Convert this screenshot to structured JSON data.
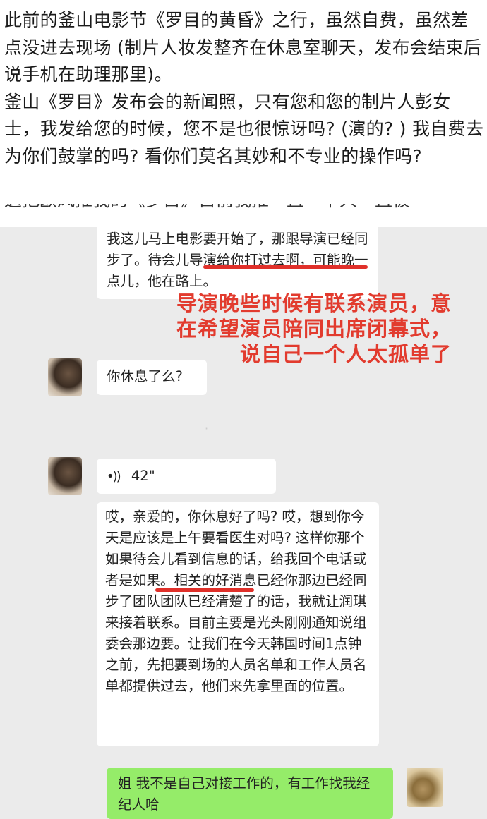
{
  "post": {
    "paragraph1": "此前的釜山电影节《罗目的黄昏》之行，虽然自费，虽然差点没进去现场 (制片人妆发整齐在休息室聊天，发布会结束后说手机在助理那里)。",
    "paragraph2": "釜山《罗目》发布会的新闻照，只有您和您的制片人彭女士，我发给您的时候，您不是也很惊讶吗? (演的? ) 我自费去为你们鼓掌的吗? 看你们莫名其妙和不专业的操作吗?",
    "cut_line": "这把欧风推我的《罗目》目前我推一直一下人一直被"
  },
  "chat": {
    "msg1": "我这儿马上电影要开始了，那跟导演已经同步了。待会儿导演给你打过去啊，可能晚一点儿，他在路上。",
    "annotation": "导演晚些时候有联系演员，意在希望演员陪同出席闭幕式，说自己一个人太孤单了",
    "msg2": "你休息了么?",
    "voice_icon": "voice-icon",
    "voice_duration": "42\"",
    "msg3": "哎，亲爱的，你休息好了吗? 哎，想到你今天是应该是上午要看医生对吗? 这样你那个如果待会儿看到信息的话，给我回个电话或者是如果。相关的好消息已经你那边已经同步了团队团队已经清楚了的话，我就让润琪来接着联系。目前主要是光头刚刚通知说组委会那边要。让我们在今天韩国时间1点钟之前，先把要到场的人员名单和工作人员名单都提供过去，他们来先拿里面的位置。",
    "msg4": "姐 我不是自己对接工作的，有工作找我经纪人哈"
  },
  "colors": {
    "annotation_red": "#e23b2e",
    "sent_bubble": "#95ec69",
    "chat_bg": "#ebebeb"
  }
}
